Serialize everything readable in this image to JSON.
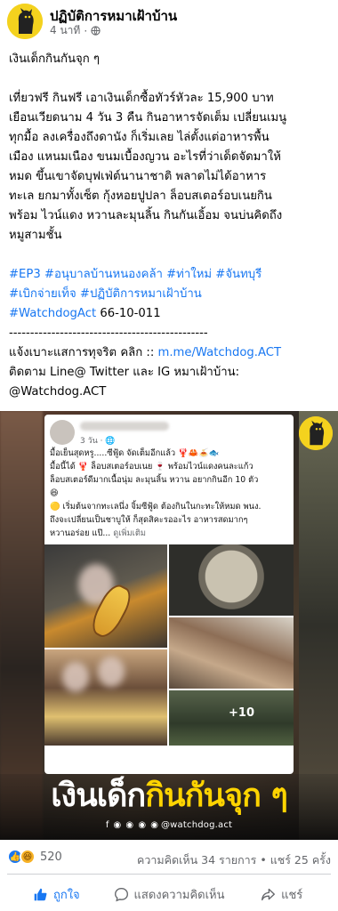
{
  "post": {
    "page_name": "ปฏิบัติการหมาเฝ้าบ้าน",
    "time": "4 นาที",
    "title_line": "เงินเด็กกินกันจุก ๆ",
    "body_lines": [
      "เที่ยวฟรี กินฟรี เอาเงินเด็กซื้อทัวร์หัวละ 15,900 บาท",
      "เยือนเวียดนาม 4 วัน 3 คืน กินอาหารจัดเต็ม เปลี่ยนเมนู",
      "ทุกมื้อ ลงเครื่องถึงดานัง ก็เริ่มเลย ไล่ตั้งแต่อาหารพื้น",
      "เมือง แหนมเนือง ขนมเบื้องญวน อะไรที่ว่าเด็ดจัดมาให้",
      "หมด ขึ้นเขาจัดบุฟเฟ่ต์นานาชาติ พลาดไม่ได้อาหาร",
      "ทะเล ยกมาทั้งเซ็ต กุ้งหอยปูปลา ล็อบสเตอร์อบเนยกิน",
      "พร้อม ไวน์แดง หวานละมุนลิ้น กินกันเอิ้อม จนบ่นคิดถึง",
      "หมูสามชั้น"
    ],
    "hashtags_line1": "#EP3 #อนุบาลบ้านหนองคล้า #ท่าใหม่ #จันทบุรี",
    "hashtags_line2_tags": "#เบิกจ่ายเท็จ #ปฏิบัติการหมาเฝ้าบ้าน",
    "hashtags_line3_tag": "#WatchdogAct",
    "hashtags_line3_code": " 66-10-011",
    "separator": "-----------------------------------------------",
    "report_prefix": "แจ้งเบาะแสการทุจริต คลิก :: ",
    "report_link": "m.me/Watchdog.ACT",
    "follow_line1": "ติดตาม Line@ Twitter และ IG หมาเฝ้าบ้าน:",
    "follow_line2": "@Watchdog.ACT"
  },
  "media": {
    "card_time": "3 วัน · 🌐",
    "card_text_lines": [
      "มื้อเย็นสุดหรู.....ซีฟู้ด จัดเต็มอีกแล้ว 🦞🦀🍝🐟",
      "มื้อนี้ได้ 🦞 ล็อบสเตอร์อบเนย 🍷 พร้อมไวน์แดงคนละแก้ว",
      "ล็อบสเตอร์ดีมากเนื้อนุ่ม ละมุนลิ้น หวาน อยากกินอีก 10 ตัว",
      "😆",
      "🟡 เริ่มต้นจากทะเลนึ่ง จิ้มซีฟู้ด ต้องกินในกะทะให้หมด พนง.",
      "ถึงจะเปลี่ยนเป็นชาบูให้ ก็สุดสิคะรออะไร อาหารสดมากๆ"
    ],
    "card_text_last": "หวานอร่อย แป๊... ",
    "card_more": "ดูเพิ่มเติม",
    "more_photos": "+10",
    "headline_white": "เงินเด็ก",
    "headline_yellow": "กินกันจุก ๆ",
    "social_icons": "f ◉ ◉ ◉ ◉",
    "social_handle": "@watchdog.act"
  },
  "stats": {
    "reaction_count": "520",
    "comments_shares": "ความคิดเห็น 34 รายการ • แชร์ 25 ครั้ง"
  },
  "actions": {
    "like_label": "ถูกใจ",
    "comment_label": "แสดงความคิดเห็น",
    "share_label": "แชร์"
  },
  "colors": {
    "link_blue": "#1877f2",
    "brand_yellow": "#ffd400",
    "meta_gray": "#65676b"
  },
  "icons": [
    "dog-logo-icon",
    "globe-icon",
    "like-icon",
    "haha-icon",
    "thumbs-up-icon",
    "comment-icon",
    "share-icon"
  ]
}
